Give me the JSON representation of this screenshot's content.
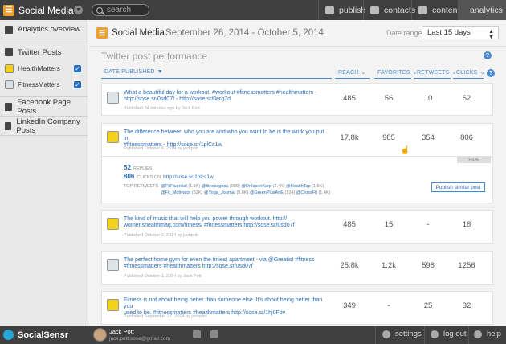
{
  "topbar": {
    "brand": "Social Media",
    "search_placeholder": "search",
    "nav": [
      {
        "label": "publish"
      },
      {
        "label": "contacts"
      },
      {
        "label": "content"
      },
      {
        "label": "analytics"
      }
    ]
  },
  "sidebar": {
    "analytics_overview": "Analytics overview",
    "twitter_posts": "Twitter Posts",
    "accounts": [
      {
        "name": "HealthMatters"
      },
      {
        "name": "FitnessMatters"
      }
    ],
    "facebook": "Facebook Page Posts",
    "linkedin": "LinkedIn Company Posts"
  },
  "header": {
    "title": "Social Media",
    "dates": "- September 26, 2014 - October 5, 2014",
    "date_range_label": "Date range:",
    "date_range_value": "Last 15 days"
  },
  "section_title": "Twitter post performance",
  "columns": {
    "date": "DATE PUBLISHED",
    "reach": "REACH",
    "favorites": "FAVORITES",
    "retweets": "RETWEETS",
    "clicks": "CLICKS"
  },
  "posts": [
    {
      "line1": "What a beautiful day for a workout.  #workout #fitnessmatters #healthmatters -",
      "line2": "http://sose.sr/0sd07f - http://sose.sr/0erg7d",
      "meta": "Published 34 minutes ago by Jack Pott",
      "reach": "485",
      "favorites": "56",
      "retweets": "10",
      "clicks": "62"
    },
    {
      "line1": "The difference between who you are and who you want to be is the work you put in.",
      "line2": "#fitnessmatters - http://sose.sr/1plCs1w",
      "meta": "Published October 6, 2014 by jackpott",
      "reach": "17.8k",
      "favorites": "985",
      "retweets": "354",
      "clicks": "806"
    },
    {
      "line1": "The kind of music that will help you power through workout. http://",
      "line2": "womenshealthmag.com/fitness/ #fitnessmatters http://sose.sr/0sd07f",
      "meta": "Published October 2, 2014 by jackpott",
      "reach": "485",
      "favorites": "15",
      "retweets": "-",
      "clicks": "18"
    },
    {
      "line1": "The perfect home gym for even the tiniest apartment - via @Greatist #fitness",
      "line2": "#fitnessmatters #healthmatters http://sose.sr/0sd07f",
      "meta": "Published October 1, 2014 by Jack Pott",
      "reach": "25.8k",
      "favorites": "1.2k",
      "retweets": "598",
      "clicks": "1256"
    },
    {
      "line1": "Fitness is not about being better than someone else. It's about being better than you",
      "line2": "used to be. #fitnessmatters #healthmatters http://sose.sr/1hj0Fbv",
      "meta": "Published September 27, 2014 by jackpott",
      "reach": "349",
      "favorites": "-",
      "retweets": "25",
      "clicks": "32"
    }
  ],
  "detail": {
    "hide": "HIDE",
    "replies_count": "52",
    "replies_label": "REPLIES",
    "clicks_count": "806",
    "clicks_label": "CLICKS ON",
    "clicks_link": "http://sose.sr/1plcs1w",
    "top_retweets_label": "TOP RETWEETS",
    "retweeters_row1": [
      {
        "name": "@FitFluential",
        "count": "(1.5K)"
      },
      {
        "name": "@fitnessgoau",
        "count": "(908)"
      },
      {
        "name": "@DrJasonKarp",
        "count": "(2.4K)"
      },
      {
        "name": "@HealthTap",
        "count": "(1.5K)"
      }
    ],
    "retweeters_row2": [
      {
        "name": "@Fit_Motivator",
        "count": "(52K)"
      },
      {
        "name": "@Yoga_Journal",
        "count": "(5.6K)"
      },
      {
        "name": "@GreenPlusAnE",
        "count": "(124)"
      },
      {
        "name": "@CrossFit",
        "count": "(1.4K)"
      }
    ],
    "publish_similar": "Publish similar post"
  },
  "bottombar": {
    "brand": "SocialSensr",
    "user_name": "Jack Pott",
    "user_email": "jack.pott.sose@gmail.com",
    "settings": "settings",
    "logout": "log out",
    "help": "help"
  },
  "colors": {
    "accent": "#2a6db8",
    "topbar": "#3f3f3f",
    "brand_orange": "#f0a030"
  }
}
